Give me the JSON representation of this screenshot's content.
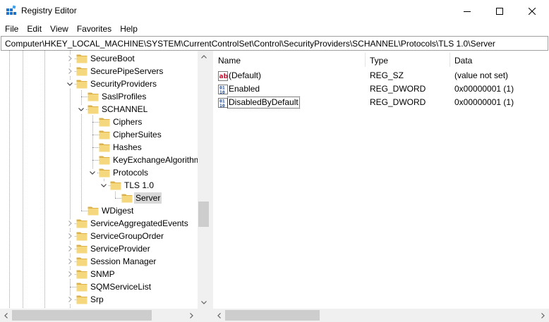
{
  "window": {
    "title": "Registry Editor",
    "minimize_icon": "minimize-icon",
    "maximize_icon": "maximize-icon",
    "close_icon": "close-icon"
  },
  "menu": [
    "File",
    "Edit",
    "View",
    "Favorites",
    "Help"
  ],
  "address": "Computer\\HKEY_LOCAL_MACHINE\\SYSTEM\\CurrentControlSet\\Control\\SecurityProviders\\SCHANNEL\\Protocols\\TLS 1.0\\Server",
  "tree": [
    {
      "label": "SecureBoot",
      "expander": "collapsed",
      "selected": false
    },
    {
      "label": "SecurePipeServers",
      "expander": "collapsed",
      "selected": false
    },
    {
      "label": "SecurityProviders",
      "expander": "expanded",
      "selected": false
    },
    {
      "label": "SaslProfiles",
      "expander": "none",
      "selected": false
    },
    {
      "label": "SCHANNEL",
      "expander": "expanded",
      "selected": false
    },
    {
      "label": "Ciphers",
      "expander": "none",
      "selected": false
    },
    {
      "label": "CipherSuites",
      "expander": "none",
      "selected": false
    },
    {
      "label": "Hashes",
      "expander": "none",
      "selected": false
    },
    {
      "label": "KeyExchangeAlgorithms",
      "expander": "none",
      "selected": false
    },
    {
      "label": "Protocols",
      "expander": "expanded",
      "selected": false
    },
    {
      "label": "TLS 1.0",
      "expander": "expanded",
      "selected": false
    },
    {
      "label": "Server",
      "expander": "none",
      "selected": true
    },
    {
      "label": "WDigest",
      "expander": "none",
      "selected": false
    },
    {
      "label": "ServiceAggregatedEvents",
      "expander": "collapsed",
      "selected": false
    },
    {
      "label": "ServiceGroupOrder",
      "expander": "collapsed",
      "selected": false
    },
    {
      "label": "ServiceProvider",
      "expander": "collapsed",
      "selected": false
    },
    {
      "label": "Session Manager",
      "expander": "collapsed",
      "selected": false
    },
    {
      "label": "SNMP",
      "expander": "collapsed",
      "selected": false
    },
    {
      "label": "SQMServiceList",
      "expander": "none",
      "selected": false
    },
    {
      "label": "Srp",
      "expander": "collapsed",
      "selected": false
    }
  ],
  "list": {
    "columns": [
      "Name",
      "Type",
      "Data"
    ],
    "rows": [
      {
        "name": "(Default)",
        "type": "REG_SZ",
        "data": "(value not set)",
        "icon": "string-value-icon",
        "focused": false
      },
      {
        "name": "Enabled",
        "type": "REG_DWORD",
        "data": "0x00000001 (1)",
        "icon": "binary-value-icon",
        "focused": false
      },
      {
        "name": "DisabledByDefault",
        "type": "REG_DWORD",
        "data": "0x00000001 (1)",
        "icon": "binary-value-icon",
        "focused": true
      }
    ]
  },
  "colors": {
    "folder": "#f5d77d",
    "folder_edge": "#dcb14a",
    "selection": "#d9d9d9",
    "scrollbar_track": "#f0f0f0",
    "scrollbar_thumb": "#cdcdcd"
  }
}
